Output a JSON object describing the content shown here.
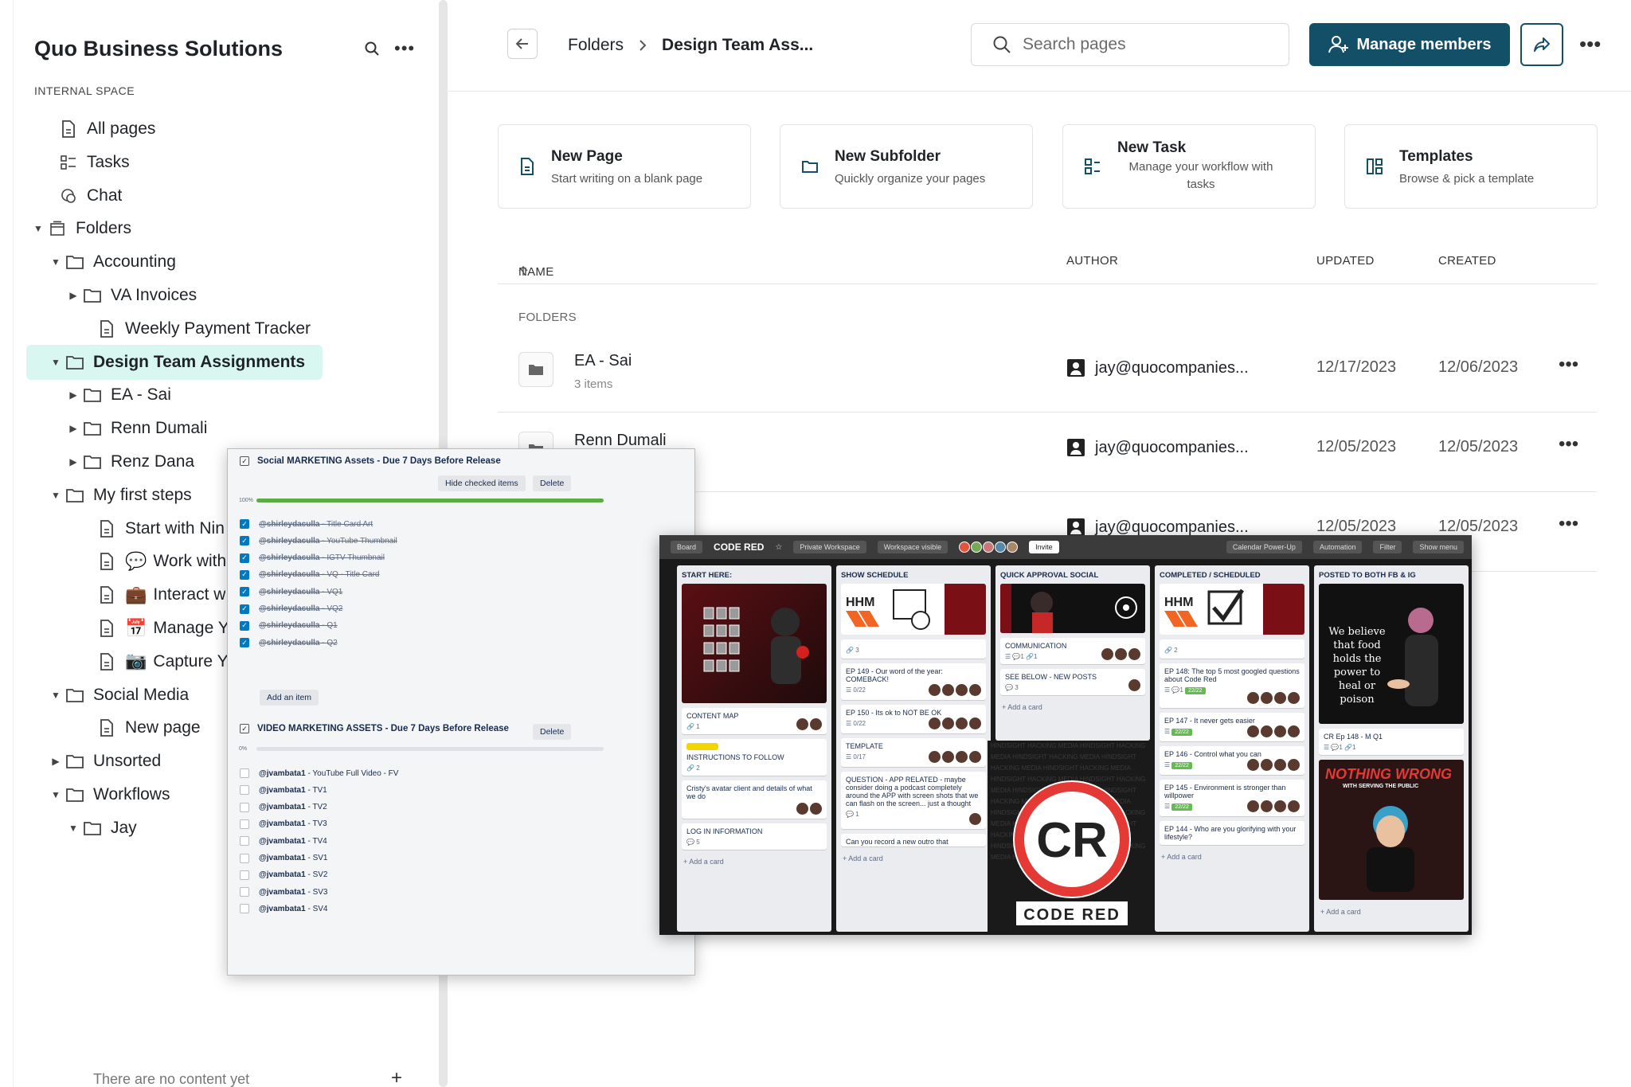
{
  "sidebar": {
    "workspace_title": "Quo Business Solutions",
    "space_label": "INTERNAL SPACE",
    "items": [
      {
        "label": "All pages",
        "icon": "page-icon"
      },
      {
        "label": "Tasks",
        "icon": "tasks-icon"
      },
      {
        "label": "Chat",
        "icon": "chat-icon"
      },
      {
        "label": "Folders",
        "icon": "archive-icon"
      },
      {
        "label": "Accounting",
        "icon": "folder-icon"
      },
      {
        "label": "VA Invoices",
        "icon": "folder-icon"
      },
      {
        "label": "Weekly Payment Tracker",
        "icon": "page-icon"
      },
      {
        "label": "Design Team Assignments",
        "icon": "folder-icon"
      },
      {
        "label": "EA - Sai",
        "icon": "folder-icon"
      },
      {
        "label": "Renn Dumali",
        "icon": "folder-icon"
      },
      {
        "label": "Renz Dana",
        "icon": "folder-icon"
      },
      {
        "label": "My first steps",
        "icon": "folder-icon"
      },
      {
        "label": "Start with Nin",
        "icon": "page-icon"
      },
      {
        "label": "Work with",
        "icon": "page-icon",
        "emoji": "💬"
      },
      {
        "label": "Interact w",
        "icon": "page-icon",
        "emoji": "💼"
      },
      {
        "label": "Manage Y",
        "icon": "page-icon",
        "emoji": "📅"
      },
      {
        "label": "Capture Y",
        "icon": "page-icon",
        "emoji": "📷"
      },
      {
        "label": "Social Media",
        "icon": "folder-icon"
      },
      {
        "label": "New page",
        "icon": "page-icon"
      },
      {
        "label": "Unsorted",
        "icon": "folder-icon"
      },
      {
        "label": "Workflows",
        "icon": "folder-icon"
      },
      {
        "label": "Jay",
        "icon": "folder-icon"
      }
    ],
    "empty_text": "There are no content yet"
  },
  "header": {
    "crumb_parent": "Folders",
    "crumb_current": "Design Team Ass...",
    "search_placeholder": "Search pages",
    "manage_label": "Manage members"
  },
  "quick_cards": [
    {
      "title": "New Page",
      "sub": "Start writing on a blank page",
      "icon": "page-icon"
    },
    {
      "title": "New Subfolder",
      "sub": "Quickly organize your pages",
      "icon": "folder-icon"
    },
    {
      "title": "New Task",
      "sub": "Manage your workflow with tasks",
      "icon": "tasks-icon"
    },
    {
      "title": "Templates",
      "sub": "Browse & pick a template",
      "icon": "templates-icon"
    }
  ],
  "table": {
    "col_name": "NAME",
    "col_author": "AUTHOR",
    "col_updated": "UPDATED",
    "col_created": "CREATED",
    "section": "FOLDERS",
    "rows": [
      {
        "name": "EA - Sai",
        "count": "3 items",
        "author": "jay@quocompanies...",
        "updated": "12/17/2023",
        "created": "12/06/2023"
      },
      {
        "name": "Renn Dumali",
        "count": "",
        "author": "jay@quocompanies...",
        "updated": "12/05/2023",
        "created": "12/05/2023"
      },
      {
        "name": "",
        "count": "",
        "author": "jay@quocompanies...",
        "updated": "12/05/2023",
        "created": "12/05/2023"
      }
    ]
  },
  "checklist": {
    "social_title": "Social MARKETING Assets - Due 7 Days Before Release",
    "hide_checked": "Hide checked items",
    "delete": "Delete",
    "social_pct": "100%",
    "social_progress": 1.0,
    "social_items": [
      {
        "user": "@shirleydaculla",
        "task": "Title Card Art"
      },
      {
        "user": "@shirleydaculla",
        "task": "YouTube Thumbnail"
      },
      {
        "user": "@shirleydaculla",
        "task": "IGTV Thumbnail"
      },
      {
        "user": "@shirleydaculla",
        "task": "VQ - Title Card"
      },
      {
        "user": "@shirleydaculla",
        "task": "VQ1"
      },
      {
        "user": "@shirleydaculla",
        "task": "VQ2"
      },
      {
        "user": "@shirleydaculla",
        "task": "Q1"
      },
      {
        "user": "@shirleydaculla",
        "task": "Q2"
      }
    ],
    "add_item": "Add an item",
    "video_title": "VIDEO MARKETING ASSETS - Due 7 Days Before Release",
    "video_pct": "0%",
    "video_progress": 0.0,
    "video_items": [
      {
        "user": "@jvambata1",
        "task": "YouTube Full Video - FV"
      },
      {
        "user": "@jvambata1",
        "task": "TV1"
      },
      {
        "user": "@jvambata1",
        "task": "TV2"
      },
      {
        "user": "@jvambata1",
        "task": "TV3"
      },
      {
        "user": "@jvambata1",
        "task": "TV4"
      },
      {
        "user": "@jvambata1",
        "task": "SV1"
      },
      {
        "user": "@jvambata1",
        "task": "SV2"
      },
      {
        "user": "@jvambata1",
        "task": "SV3"
      },
      {
        "user": "@jvambata1",
        "task": "SV4"
      }
    ]
  },
  "board": {
    "name": "CODE RED",
    "board_btn": "Board",
    "visibility": "Private Workspace",
    "workspace_visible": "Workspace visible",
    "invite": "Invite",
    "calendar": "Calendar Power-Up",
    "automation": "Automation",
    "filter": "Filter",
    "show_menu": "Show menu",
    "add_card": "+ Add a card",
    "lists": [
      {
        "title": "START HERE:",
        "cards": [
          "CONTENT MAP",
          "INSTRUCTIONS TO FOLLOW",
          "Cristy's avatar client and details of what we do",
          "LOG IN INFORMATION"
        ]
      },
      {
        "title": "SHOW SCHEDULE",
        "cards": [
          "EP 149 - Our word of the year: COMEBACK!",
          "EP 150 - Its ok to NOT BE OK",
          "TEMPLATE",
          "QUESTION - APP RELATED - maybe consider doing a podcast completely around the APP with screen shots that we can flash on the screen... just a thought",
          "Can you record a new outro that"
        ]
      },
      {
        "title": "QUICK APPROVAL SOCIAL",
        "cards": [
          "COMMUNICATION",
          "SEE BELOW - NEW POSTS"
        ]
      },
      {
        "title": "COMPLETED / SCHEDULED",
        "cards": [
          "EP 148: The top 5 most googled questions about Code Red",
          "EP 147 - It never gets easier",
          "EP 146 - Control what you can",
          "EP 145 - Environment is stronger than willpower",
          "EP 144 - Who are you glorifying with your lifestyle?"
        ]
      },
      {
        "title": "POSTED to BOTH FB & IG",
        "cards": [
          "CR Ep 148 - M Q1"
        ]
      }
    ],
    "logo_text": "CODE RED",
    "logo_mark": "CR",
    "food_quote": "We believe that food holds the power to heal or poison",
    "nothing_wrong": "NOTHING WRONG",
    "nothing_sub": "WITH SERVING THE PUBLIC",
    "hhm": "HHM",
    "media_strip": "HINDSIGHT HACKING MEDIA",
    "badge": "22/22",
    "meta_a": "0/22",
    "meta_b": "0/17",
    "count_1": "1",
    "count_2": "2",
    "count_3": "3",
    "count_5": "5"
  }
}
